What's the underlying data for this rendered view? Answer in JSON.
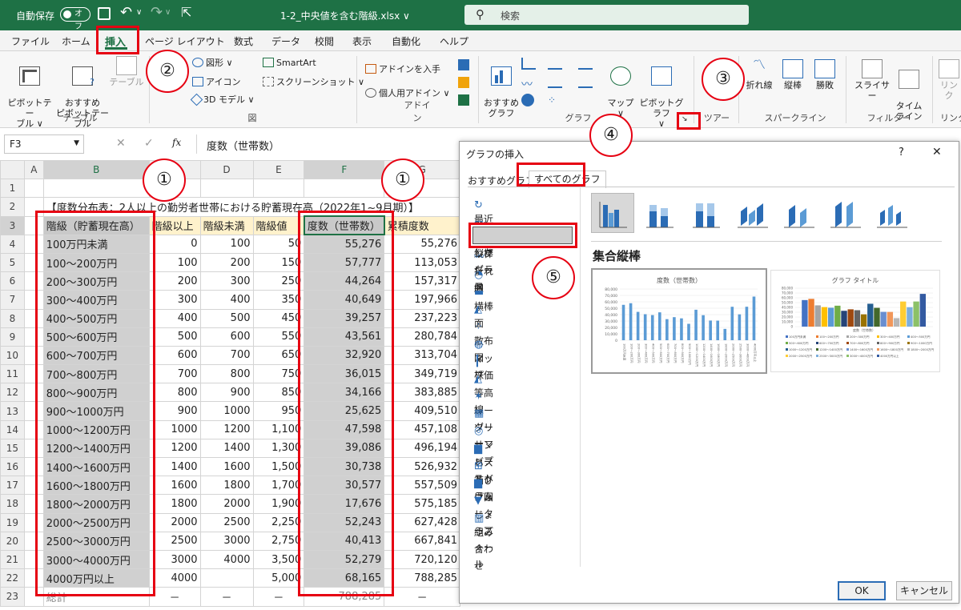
{
  "titlebar": {
    "autosave_label": "自動保存",
    "autosave_state": "オフ",
    "filename": "1-2_中央値を含む階級.xlsx ∨",
    "search_placeholder": "検索"
  },
  "menu_tabs": [
    "ファイル",
    "ホーム",
    "挿入",
    "ページ レイアウト",
    "数式",
    "データ",
    "校閲",
    "表示",
    "自動化",
    "ヘルプ"
  ],
  "ribbon": {
    "pivot_table": "ピボットテー\nブル ∨",
    "recommended_pivot": "おすすめ\nピボットテーブル",
    "table": "テーブル",
    "group_table": "テーブル",
    "shapes": "図形 ∨",
    "icons": "アイコン",
    "model3d": "3D モデル ∨",
    "smartart": "SmartArt",
    "screenshot": "スクリーンショット ∨",
    "group_figure": "図",
    "get_addin": "アドインを入手",
    "personal_addin": "個人用アドイン ∨",
    "group_addin": "アドイン",
    "recommended_chart": "おすすめ\nグラフ",
    "map": "マップ\n∨",
    "pivot_chart": "ピボットグラフ\n∨",
    "group_chart": "グラフ",
    "tour": "ツアー",
    "line_spark": "折れ線",
    "column_spark": "縦棒",
    "winloss": "勝敗",
    "group_sparkline": "スパークライン",
    "slicer": "スライサー",
    "timeline": "タイム\nライン",
    "group_filter": "フィルター",
    "link": "リンク",
    "group_link": "リンク"
  },
  "formula_bar": {
    "namebox": "F3",
    "fx": "fx",
    "formula": "度数（世帯数）"
  },
  "sheet": {
    "columns": [
      "A",
      "B",
      "C",
      "D",
      "E",
      "F",
      "G"
    ],
    "row2_title": "【度数分布表：2人以上の勤労者世帯における貯蓄現在高（2022年1~9月期）】",
    "headers": [
      "階級（貯蓄現在高）",
      "階級以上",
      "階級未満",
      "階級値",
      "度数（世帯数）",
      "累積度数"
    ],
    "rows": [
      {
        "r": "4",
        "b": "100万円未満",
        "c": "0",
        "d": "100",
        "e": "50",
        "f": "55,276",
        "g": "55,276"
      },
      {
        "r": "5",
        "b": "100～200万円",
        "c": "100",
        "d": "200",
        "e": "150",
        "f": "57,777",
        "g": "113,053"
      },
      {
        "r": "6",
        "b": "200～300万円",
        "c": "200",
        "d": "300",
        "e": "250",
        "f": "44,264",
        "g": "157,317"
      },
      {
        "r": "7",
        "b": "300～400万円",
        "c": "300",
        "d": "400",
        "e": "350",
        "f": "40,649",
        "g": "197,966"
      },
      {
        "r": "8",
        "b": "400～500万円",
        "c": "400",
        "d": "500",
        "e": "450",
        "f": "39,257",
        "g": "237,223"
      },
      {
        "r": "9",
        "b": "500～600万円",
        "c": "500",
        "d": "600",
        "e": "550",
        "f": "43,561",
        "g": "280,784"
      },
      {
        "r": "10",
        "b": "600～700万円",
        "c": "600",
        "d": "700",
        "e": "650",
        "f": "32,920",
        "g": "313,704"
      },
      {
        "r": "11",
        "b": "700～800万円",
        "c": "700",
        "d": "800",
        "e": "750",
        "f": "36,015",
        "g": "349,719"
      },
      {
        "r": "12",
        "b": "800～900万円",
        "c": "800",
        "d": "900",
        "e": "850",
        "f": "34,166",
        "g": "383,885"
      },
      {
        "r": "13",
        "b": "900～1000万円",
        "c": "900",
        "d": "1000",
        "e": "950",
        "f": "25,625",
        "g": "409,510"
      },
      {
        "r": "14",
        "b": "1000～1200万円",
        "c": "1000",
        "d": "1200",
        "e": "1,100",
        "f": "47,598",
        "g": "457,108"
      },
      {
        "r": "15",
        "b": "1200～1400万円",
        "c": "1200",
        "d": "1400",
        "e": "1,300",
        "f": "39,086",
        "g": "496,194"
      },
      {
        "r": "16",
        "b": "1400～1600万円",
        "c": "1400",
        "d": "1600",
        "e": "1,500",
        "f": "30,738",
        "g": "526,932"
      },
      {
        "r": "17",
        "b": "1600～1800万円",
        "c": "1600",
        "d": "1800",
        "e": "1,700",
        "f": "30,577",
        "g": "557,509"
      },
      {
        "r": "18",
        "b": "1800～2000万円",
        "c": "1800",
        "d": "2000",
        "e": "1,900",
        "f": "17,676",
        "g": "575,185"
      },
      {
        "r": "19",
        "b": "2000～2500万円",
        "c": "2000",
        "d": "2500",
        "e": "2,250",
        "f": "52,243",
        "g": "627,428"
      },
      {
        "r": "20",
        "b": "2500～3000万円",
        "c": "2500",
        "d": "3000",
        "e": "2,750",
        "f": "40,413",
        "g": "667,841"
      },
      {
        "r": "21",
        "b": "3000～4000万円",
        "c": "3000",
        "d": "4000",
        "e": "3,500",
        "f": "52,279",
        "g": "720,120"
      },
      {
        "r": "22",
        "b": "4000万円以上",
        "c": "4000",
        "d": "",
        "e": "5,000",
        "f": "68,165",
        "g": "788,285"
      },
      {
        "r": "23",
        "b": "総計",
        "c": "－",
        "d": "－",
        "e": "－",
        "f": "788,285",
        "g": "－"
      }
    ]
  },
  "callouts": [
    "①",
    "②",
    "③",
    "④",
    "①",
    "⑤"
  ],
  "dialog": {
    "title": "グラフの挿入",
    "help": "?",
    "close": "✕",
    "tab_recommended": "おすすめグラフ",
    "tab_all": "すべてのグラフ",
    "chart_types": [
      "最近使用したグラフ",
      "テンプレート",
      "縦棒",
      "折れ線",
      "円",
      "横棒",
      "面",
      "散布図",
      "マップ",
      "株価",
      "等高線",
      "レーダー",
      "ツリーマップ",
      "サンバースト",
      "ヒストグラム",
      "箱ひげ図",
      "ウォーターフォール",
      "じょうご",
      "組み合わせ"
    ],
    "selected_type_name": "集合縦棒",
    "preview1_title": "度数（世帯数）",
    "preview2_title": "グラフ タイトル",
    "preview_yticks": [
      "80,000",
      "70,000",
      "60,000",
      "50,000",
      "40,000",
      "30,000",
      "20,000",
      "10,000",
      "0"
    ],
    "preview2_yticks": [
      "80,000",
      "70,000",
      "60,000",
      "50,000",
      "40,000",
      "30,000",
      "20,000",
      "10,000",
      "0"
    ],
    "preview2_axis_label": "度数（世帯数）",
    "preview2_legend": [
      "100万円未満",
      "100～200万円",
      "200～300万円",
      "300～400万円",
      "400～500万円",
      "500～600万円",
      "600～700万円",
      "700～800万円",
      "800～900万円",
      "900～1000万円",
      "1000～1200万円",
      "1200～1400万円",
      "1400～1600万円",
      "1600～1800万円",
      "1800～2000万円",
      "2000～2500万円",
      "2500～3000万円",
      "3000～4000万円",
      "4000万円以上"
    ],
    "ok": "OK",
    "cancel": "キャンセル"
  },
  "chart_data": [
    {
      "type": "bar",
      "title": "度数（世帯数）",
      "categories": [
        "100万円未満",
        "100～200万円",
        "200～300万円",
        "300～400万円",
        "400～500万円",
        "500～600万円",
        "600～700万円",
        "700～800万円",
        "800～900万円",
        "900～1000万円",
        "1000～1200万円",
        "1200～1400万円",
        "1400～1600万円",
        "1600～1800万円",
        "1800～2000万円",
        "2000～2500万円",
        "2500～3000万円",
        "3000～4000万円",
        "4000万円以上"
      ],
      "values": [
        55276,
        57777,
        44264,
        40649,
        39257,
        43561,
        32920,
        36015,
        34166,
        25625,
        47598,
        39086,
        30738,
        30577,
        17676,
        52243,
        40413,
        52279,
        68165
      ],
      "ylim": [
        0,
        80000
      ]
    },
    {
      "type": "bar",
      "title": "グラフ タイトル",
      "xlabel": "度数（世帯数）",
      "categories": [
        "度数（世帯数）"
      ],
      "series": [
        {
          "name": "100万円未満",
          "values": [
            55276
          ]
        },
        {
          "name": "100～200万円",
          "values": [
            57777
          ]
        },
        {
          "name": "200～300万円",
          "values": [
            44264
          ]
        },
        {
          "name": "300～400万円",
          "values": [
            40649
          ]
        },
        {
          "name": "400～500万円",
          "values": [
            39257
          ]
        },
        {
          "name": "500～600万円",
          "values": [
            43561
          ]
        },
        {
          "name": "600～700万円",
          "values": [
            32920
          ]
        },
        {
          "name": "700～800万円",
          "values": [
            36015
          ]
        },
        {
          "name": "800～900万円",
          "values": [
            34166
          ]
        },
        {
          "name": "900～1000万円",
          "values": [
            25625
          ]
        },
        {
          "name": "1000～1200万円",
          "values": [
            47598
          ]
        },
        {
          "name": "1200～1400万円",
          "values": [
            39086
          ]
        },
        {
          "name": "1400～1600万円",
          "values": [
            30738
          ]
        },
        {
          "name": "1600～1800万円",
          "values": [
            30577
          ]
        },
        {
          "name": "1800～2000万円",
          "values": [
            17676
          ]
        },
        {
          "name": "2000～2500万円",
          "values": [
            52243
          ]
        },
        {
          "name": "2500～3000万円",
          "values": [
            40413
          ]
        },
        {
          "name": "3000～4000万円",
          "values": [
            52279
          ]
        },
        {
          "name": "4000万円以上",
          "values": [
            68165
          ]
        }
      ],
      "ylim": [
        0,
        80000
      ],
      "colors": [
        "#4472c4",
        "#ed7d31",
        "#a5a5a5",
        "#ffc000",
        "#5b9bd5",
        "#70ad47",
        "#264478",
        "#9e480e",
        "#636363",
        "#997300",
        "#255e91",
        "#43682b",
        "#698ed0",
        "#f1975a",
        "#b7b7b7",
        "#ffcd33",
        "#7cafdd",
        "#8cc168",
        "#335aa1"
      ],
      "legend": "bottom"
    }
  ]
}
